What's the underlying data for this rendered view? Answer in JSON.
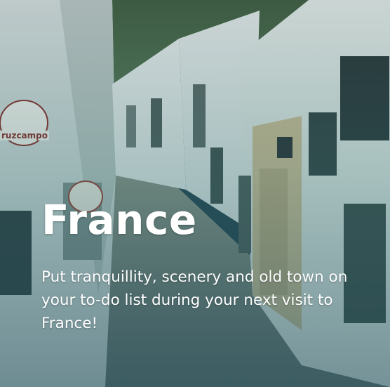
{
  "card": {
    "title": "France",
    "description": "Put tranquillity, scenery and old town on your to-do list during your next visit to France!"
  },
  "background": {
    "signs": [
      "ruzcampo"
    ]
  }
}
